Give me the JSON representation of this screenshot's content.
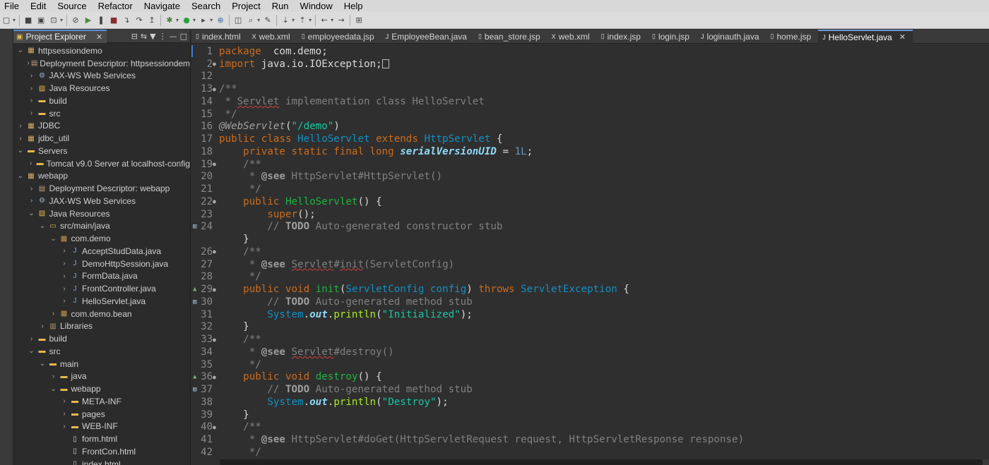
{
  "menu": [
    "File",
    "Edit",
    "Source",
    "Refactor",
    "Navigate",
    "Search",
    "Project",
    "Run",
    "Window",
    "Help"
  ],
  "toolbar_icons": [
    "new-icon",
    "save-icon",
    "save-all-icon",
    "properties-icon",
    "skip-breakpoints-icon",
    "resume-icon",
    "suspend-icon",
    "terminate-icon",
    "step-into-icon",
    "step-over-icon",
    "step-return-icon",
    "debug-icon",
    "run-icon",
    "external-tools-icon",
    "new-server-icon",
    "open-type-icon",
    "search-icon",
    "toggle-mark-icon",
    "next-annotation-icon",
    "prev-annotation-icon",
    "back-icon",
    "forward-icon",
    "pin-editor-icon"
  ],
  "explorer": {
    "title": "Project Explorer",
    "tree": [
      {
        "label": "httpsessiondemo",
        "depth": 0,
        "open": true,
        "icon": "project-icon"
      },
      {
        "label": "Deployment Descriptor: httpsessiondem",
        "depth": 1,
        "open": false,
        "icon": "descriptor-icon"
      },
      {
        "label": "JAX-WS Web Services",
        "depth": 1,
        "open": false,
        "icon": "webservice-icon"
      },
      {
        "label": "Java Resources",
        "depth": 1,
        "open": false,
        "icon": "java-resources-icon"
      },
      {
        "label": "build",
        "depth": 1,
        "open": false,
        "icon": "folder-icon"
      },
      {
        "label": "src",
        "depth": 1,
        "open": false,
        "icon": "folder-icon"
      },
      {
        "label": "JDBC",
        "depth": 0,
        "open": false,
        "icon": "project-icon"
      },
      {
        "label": "jdbc_util",
        "depth": 0,
        "open": false,
        "icon": "project-icon"
      },
      {
        "label": "Servers",
        "depth": 0,
        "open": true,
        "icon": "folder-icon"
      },
      {
        "label": "Tomcat v9.0 Server at localhost-config",
        "depth": 1,
        "open": false,
        "icon": "folder-icon"
      },
      {
        "label": "webapp",
        "depth": 0,
        "open": true,
        "icon": "project-icon"
      },
      {
        "label": "Deployment Descriptor: webapp",
        "depth": 1,
        "open": false,
        "icon": "descriptor-icon"
      },
      {
        "label": "JAX-WS Web Services",
        "depth": 1,
        "open": false,
        "icon": "webservice-icon"
      },
      {
        "label": "Java Resources",
        "depth": 1,
        "open": true,
        "icon": "java-resources-icon"
      },
      {
        "label": "src/main/java",
        "depth": 2,
        "open": true,
        "icon": "source-folder-icon"
      },
      {
        "label": "com.demo",
        "depth": 3,
        "open": true,
        "icon": "package-icon"
      },
      {
        "label": "AcceptStudData.java",
        "depth": 4,
        "open": false,
        "icon": "java-file-icon"
      },
      {
        "label": "DemoHttpSession.java",
        "depth": 4,
        "open": false,
        "icon": "java-file-icon"
      },
      {
        "label": "FormData.java",
        "depth": 4,
        "open": false,
        "icon": "java-file-icon"
      },
      {
        "label": "FrontController.java",
        "depth": 4,
        "open": false,
        "icon": "java-file-icon"
      },
      {
        "label": "HelloServlet.java",
        "depth": 4,
        "open": false,
        "icon": "java-file-icon"
      },
      {
        "label": "com.demo.bean",
        "depth": 3,
        "open": false,
        "icon": "package-icon"
      },
      {
        "label": "Libraries",
        "depth": 2,
        "open": false,
        "icon": "library-icon"
      },
      {
        "label": "build",
        "depth": 1,
        "open": false,
        "icon": "folder-icon"
      },
      {
        "label": "src",
        "depth": 1,
        "open": true,
        "icon": "folder-icon"
      },
      {
        "label": "main",
        "depth": 2,
        "open": true,
        "icon": "folder-icon"
      },
      {
        "label": "java",
        "depth": 3,
        "open": false,
        "icon": "folder-icon"
      },
      {
        "label": "webapp",
        "depth": 3,
        "open": true,
        "icon": "folder-icon"
      },
      {
        "label": "META-INF",
        "depth": 4,
        "open": false,
        "icon": "folder-icon"
      },
      {
        "label": "pages",
        "depth": 4,
        "open": false,
        "icon": "folder-icon"
      },
      {
        "label": "WEB-INF",
        "depth": 4,
        "open": false,
        "icon": "folder-icon"
      },
      {
        "label": "form.html",
        "depth": 4,
        "open": null,
        "icon": "html-file-icon"
      },
      {
        "label": "FrontCon.html",
        "depth": 4,
        "open": null,
        "icon": "html-file-icon"
      },
      {
        "label": "index.html",
        "depth": 4,
        "open": null,
        "icon": "html-file-icon"
      }
    ]
  },
  "editor": {
    "tabs": [
      {
        "label": "index.html",
        "active": false,
        "icon": "html-file-icon"
      },
      {
        "label": "web.xml",
        "active": false,
        "icon": "xml-file-icon"
      },
      {
        "label": "employeedata.jsp",
        "active": false,
        "icon": "jsp-file-icon"
      },
      {
        "label": "EmployeeBean.java",
        "active": false,
        "icon": "java-file-icon"
      },
      {
        "label": "bean_store.jsp",
        "active": false,
        "icon": "jsp-file-icon"
      },
      {
        "label": "web.xml",
        "active": false,
        "icon": "xml-file-icon"
      },
      {
        "label": "index.jsp",
        "active": false,
        "icon": "jsp-file-icon"
      },
      {
        "label": "login.jsp",
        "active": false,
        "icon": "jsp-file-icon"
      },
      {
        "label": "loginauth.java",
        "active": false,
        "icon": "java-file-icon"
      },
      {
        "label": "home.jsp",
        "active": false,
        "icon": "jsp-file-icon"
      },
      {
        "label": "HelloServlet.java",
        "active": true,
        "icon": "java-file-icon"
      }
    ],
    "lines": [
      {
        "n": "1",
        "mark": "",
        "gicon": "",
        "tokens": [
          [
            "kw",
            "package"
          ],
          [
            "",
            "  com.demo;"
          ]
        ]
      },
      {
        "n": "2",
        "mark": "fold",
        "gicon": "",
        "tokens": [
          [
            "kw",
            "import"
          ],
          [
            "",
            " java.io.IOException;"
          ],
          [
            "box",
            ""
          ]
        ]
      },
      {
        "n": "12",
        "mark": "",
        "gicon": "",
        "tokens": []
      },
      {
        "n": "13",
        "mark": "fold",
        "gicon": "",
        "tokens": [
          [
            "jd",
            "/**"
          ]
        ]
      },
      {
        "n": "14",
        "mark": "",
        "gicon": "",
        "tokens": [
          [
            "jd",
            " * "
          ],
          [
            "jdul",
            "Servlet"
          ],
          [
            "jd",
            " implementation class HelloServlet"
          ]
        ]
      },
      {
        "n": "15",
        "mark": "",
        "gicon": "",
        "tokens": [
          [
            "jd",
            " */"
          ]
        ]
      },
      {
        "n": "16",
        "mark": "",
        "gicon": "",
        "tokens": [
          [
            "ann",
            "@WebServlet"
          ],
          [
            "",
            "("
          ],
          [
            "str",
            "\"/demo\""
          ],
          [
            "",
            ")"
          ]
        ]
      },
      {
        "n": "17",
        "mark": "",
        "gicon": "",
        "tokens": [
          [
            "kw",
            "public class"
          ],
          [
            "",
            " "
          ],
          [
            "cls",
            "HelloServlet"
          ],
          [
            "",
            " "
          ],
          [
            "kw",
            "extends"
          ],
          [
            "",
            " "
          ],
          [
            "cls",
            "HttpServlet"
          ],
          [
            "",
            " {"
          ]
        ]
      },
      {
        "n": "18",
        "mark": "",
        "gicon": "",
        "tokens": [
          [
            "",
            "    "
          ],
          [
            "kw",
            "private static final long"
          ],
          [
            "",
            " "
          ],
          [
            "field",
            "serialVersionUID"
          ],
          [
            "",
            " = "
          ],
          [
            "num",
            "1L"
          ],
          [
            "",
            ";"
          ]
        ]
      },
      {
        "n": "19",
        "mark": "fold",
        "gicon": "",
        "tokens": [
          [
            "jd",
            "    /**"
          ]
        ]
      },
      {
        "n": "20",
        "mark": "",
        "gicon": "",
        "tokens": [
          [
            "jd",
            "     * "
          ],
          [
            "jdtag",
            "@see"
          ],
          [
            "jd",
            " HttpServlet#HttpServlet()"
          ]
        ]
      },
      {
        "n": "21",
        "mark": "",
        "gicon": "",
        "tokens": [
          [
            "jd",
            "     */"
          ]
        ]
      },
      {
        "n": "22",
        "mark": "fold",
        "gicon": "",
        "tokens": [
          [
            "",
            "    "
          ],
          [
            "kw",
            "public"
          ],
          [
            "",
            " "
          ],
          [
            "ctor",
            "HelloServlet"
          ],
          [
            "",
            "() {"
          ]
        ]
      },
      {
        "n": "23",
        "mark": "",
        "gicon": "",
        "tokens": [
          [
            "",
            "        "
          ],
          [
            "kw",
            "super"
          ],
          [
            "",
            "();"
          ]
        ]
      },
      {
        "n": "24",
        "mark": "",
        "gicon": "task",
        "tokens": [
          [
            "cmt",
            "        // "
          ],
          [
            "todo",
            "TODO"
          ],
          [
            "cmt",
            " Auto-generated constructor stub"
          ]
        ]
      },
      {
        "n": "",
        "mark": "",
        "gicon": "",
        "tokens": [
          [
            "",
            "    }"
          ]
        ]
      },
      {
        "n": "26",
        "mark": "fold",
        "gicon": "",
        "tokens": [
          [
            "jd",
            "    /**"
          ]
        ]
      },
      {
        "n": "27",
        "mark": "",
        "gicon": "",
        "tokens": [
          [
            "jd",
            "     * "
          ],
          [
            "jdtag",
            "@see"
          ],
          [
            "jd",
            " "
          ],
          [
            "jdul",
            "Servlet"
          ],
          [
            "jd",
            "#"
          ],
          [
            "jdul",
            "init"
          ],
          [
            "jd",
            "(ServletConfig)"
          ]
        ]
      },
      {
        "n": "28",
        "mark": "",
        "gicon": "",
        "tokens": [
          [
            "jd",
            "     */"
          ]
        ]
      },
      {
        "n": "29",
        "mark": "fold",
        "gicon": "override",
        "tokens": [
          [
            "",
            "    "
          ],
          [
            "kw",
            "public void"
          ],
          [
            "",
            " "
          ],
          [
            "mth",
            "init"
          ],
          [
            "",
            "("
          ],
          [
            "cls",
            "ServletConfig"
          ],
          [
            "",
            " "
          ],
          [
            "cls",
            "config"
          ],
          [
            "",
            ") "
          ],
          [
            "kw",
            "throws"
          ],
          [
            "",
            " "
          ],
          [
            "cls",
            "ServletException"
          ],
          [
            "",
            " {"
          ]
        ]
      },
      {
        "n": "30",
        "mark": "",
        "gicon": "task",
        "tokens": [
          [
            "cmt",
            "        // "
          ],
          [
            "todo",
            "TODO"
          ],
          [
            "cmt",
            " Auto-generated method stub"
          ]
        ]
      },
      {
        "n": "31",
        "mark": "",
        "gicon": "",
        "tokens": [
          [
            "",
            "        "
          ],
          [
            "cls",
            "System"
          ],
          [
            "",
            "."
          ],
          [
            "sfield",
            "out"
          ],
          [
            "",
            "."
          ],
          [
            "call",
            "println"
          ],
          [
            "",
            "("
          ],
          [
            "str",
            "\"Initialized\""
          ],
          [
            "",
            ");"
          ]
        ]
      },
      {
        "n": "32",
        "mark": "",
        "gicon": "",
        "tokens": [
          [
            "",
            "    }"
          ]
        ]
      },
      {
        "n": "33",
        "mark": "fold",
        "gicon": "",
        "tokens": [
          [
            "jd",
            "    /**"
          ]
        ]
      },
      {
        "n": "34",
        "mark": "",
        "gicon": "",
        "tokens": [
          [
            "jd",
            "     * "
          ],
          [
            "jdtag",
            "@see"
          ],
          [
            "jd",
            " "
          ],
          [
            "jdul",
            "Servlet"
          ],
          [
            "jd",
            "#destroy()"
          ]
        ]
      },
      {
        "n": "35",
        "mark": "",
        "gicon": "",
        "tokens": [
          [
            "jd",
            "     */"
          ]
        ]
      },
      {
        "n": "36",
        "mark": "fold",
        "gicon": "override",
        "tokens": [
          [
            "",
            "    "
          ],
          [
            "kw",
            "public void"
          ],
          [
            "",
            " "
          ],
          [
            "mth",
            "destroy"
          ],
          [
            "",
            "() {"
          ]
        ]
      },
      {
        "n": "37",
        "mark": "",
        "gicon": "task",
        "tokens": [
          [
            "cmt",
            "        // "
          ],
          [
            "todo",
            "TODO"
          ],
          [
            "cmt",
            " Auto-generated method stub"
          ]
        ]
      },
      {
        "n": "38",
        "mark": "",
        "gicon": "",
        "tokens": [
          [
            "",
            "        "
          ],
          [
            "cls",
            "System"
          ],
          [
            "",
            "."
          ],
          [
            "sfield",
            "out"
          ],
          [
            "",
            "."
          ],
          [
            "call",
            "println"
          ],
          [
            "",
            "("
          ],
          [
            "str",
            "\"Destroy\""
          ],
          [
            "",
            ");"
          ]
        ]
      },
      {
        "n": "39",
        "mark": "",
        "gicon": "",
        "tokens": [
          [
            "",
            "    }"
          ]
        ]
      },
      {
        "n": "40",
        "mark": "fold",
        "gicon": "",
        "tokens": [
          [
            "jd",
            "    /**"
          ]
        ]
      },
      {
        "n": "41",
        "mark": "",
        "gicon": "",
        "tokens": [
          [
            "jd",
            "     * "
          ],
          [
            "jdtag",
            "@see"
          ],
          [
            "jd",
            " HttpServlet#doGet(HttpServletRequest request, HttpServletResponse response)"
          ]
        ]
      },
      {
        "n": "42",
        "mark": "",
        "gicon": "",
        "tokens": [
          [
            "jd",
            "     */"
          ]
        ]
      }
    ]
  }
}
